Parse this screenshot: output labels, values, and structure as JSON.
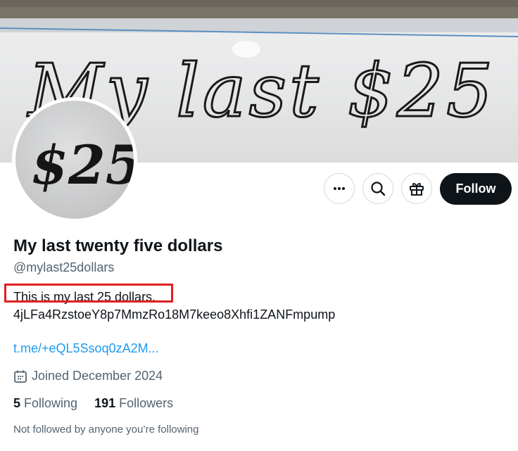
{
  "banner": {
    "handwriting": "My last $25",
    "icon": "banner-image"
  },
  "avatar": {
    "handwriting": "$25",
    "icon": "avatar-image"
  },
  "actions": {
    "more_icon": "more-icon",
    "search_icon": "search-icon",
    "gift_icon": "gift-icon",
    "follow_label": "Follow"
  },
  "profile": {
    "display_name": "My last twenty five dollars",
    "handle": "@mylast25dollars",
    "bio_line1": "This is my last 25 dollars.",
    "bio_line2": "4jLFa4RzstoeY8p7MmzRo18M7keeo8Xhfi1ZANFmpump",
    "link": "t.me/+eQL5Ssoq0zA2M...",
    "joined": "Joined December 2024",
    "calendar_icon": "calendar-icon",
    "following_count": "5",
    "following_label": "Following",
    "followers_count": "191",
    "followers_label": "Followers",
    "not_followed_text": "Not followed by anyone you’re following"
  },
  "colors": {
    "link": "#1d9bf0",
    "secondary_text": "#536471",
    "follow_button": "#0f1419",
    "highlight_box": "#e02020"
  }
}
